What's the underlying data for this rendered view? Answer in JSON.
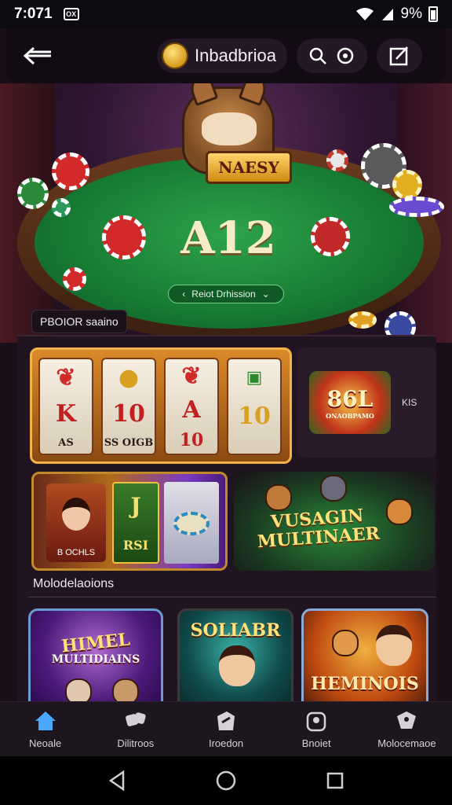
{
  "status_bar": {
    "time": "7:071",
    "notif": "OX",
    "battery": "9%"
  },
  "header": {
    "back_icon": "arrow-left-icon",
    "brand": "Inbadbrioa",
    "search_icon": "search-icon",
    "settings_icon": "target-icon",
    "edit_icon": "edit-icon"
  },
  "hero": {
    "mascot_badge": "NAESY",
    "jackpot": "A12",
    "cta": "Reiot Drhission",
    "label": "PBOIOR saaino"
  },
  "games": {
    "slot_reels": [
      {
        "top": "K",
        "bottom": "AS"
      },
      {
        "top": "10",
        "bottom": "SS OIGB"
      },
      {
        "top": "A",
        "bottom": "10"
      },
      {
        "top": "10",
        "bottom": ""
      }
    ],
    "promo": {
      "logo": "86L",
      "logo_sub": "ONAOBPAMO",
      "name": "KIS"
    },
    "lady": {
      "name": "B OCHLS",
      "reel_top": "J",
      "reel_bottom": "RSI"
    },
    "multi": {
      "title_1": "VUSAGIN",
      "title_2": "MULTINAER"
    }
  },
  "section": {
    "title": "Molodelaoions"
  },
  "tiles": [
    {
      "line1": "HIMEL",
      "line2": "MULTIDIAINS"
    },
    {
      "line1": "SOLIABR"
    },
    {
      "line1": "HEMINOIS"
    }
  ],
  "bottom_nav": [
    {
      "label": "Neoale",
      "icon": "home-icon",
      "active": true
    },
    {
      "label": "Dilitroos",
      "icon": "dice-icon",
      "active": false
    },
    {
      "label": "Iroedon",
      "icon": "tag-icon",
      "active": false
    },
    {
      "label": "Bnoiet",
      "icon": "wallet-icon",
      "active": false
    },
    {
      "label": "Molocemaoe",
      "icon": "gift-icon",
      "active": false
    }
  ],
  "colors": {
    "accent": "#4aa8ff",
    "felt": "#167a33",
    "gold": "#ffe27a"
  }
}
